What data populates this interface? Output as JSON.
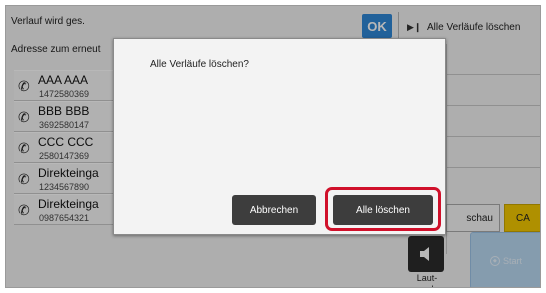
{
  "topbar": {
    "status_text": "Verlauf wird ges.",
    "ok_label": "OK",
    "clear_all_label": "Alle Verläufe löschen"
  },
  "address_label": "Adresse zum erneut",
  "history": [
    {
      "name": "AAA AAA",
      "number": "1472580369"
    },
    {
      "name": "BBB BBB",
      "number": "3692580147"
    },
    {
      "name": "CCC CCC",
      "number": "2580147369"
    },
    {
      "name": "Direkteinga",
      "number": "1234567890"
    },
    {
      "name": "Direkteinga",
      "number": "0987654321"
    }
  ],
  "buttons": {
    "preview_label": "schau",
    "ca_label": "CA",
    "speaker_label": "Laut-sprecher",
    "start_label": "Start"
  },
  "dialog": {
    "message": "Alle Verläufe löschen?",
    "cancel_label": "Abbrechen",
    "confirm_label": "Alle löschen"
  },
  "colors": {
    "ok_blue": "#2f87d6",
    "ca_yellow": "#f3c800",
    "highlight_red": "#d0102a",
    "dialog_button": "#3d3d3d"
  }
}
